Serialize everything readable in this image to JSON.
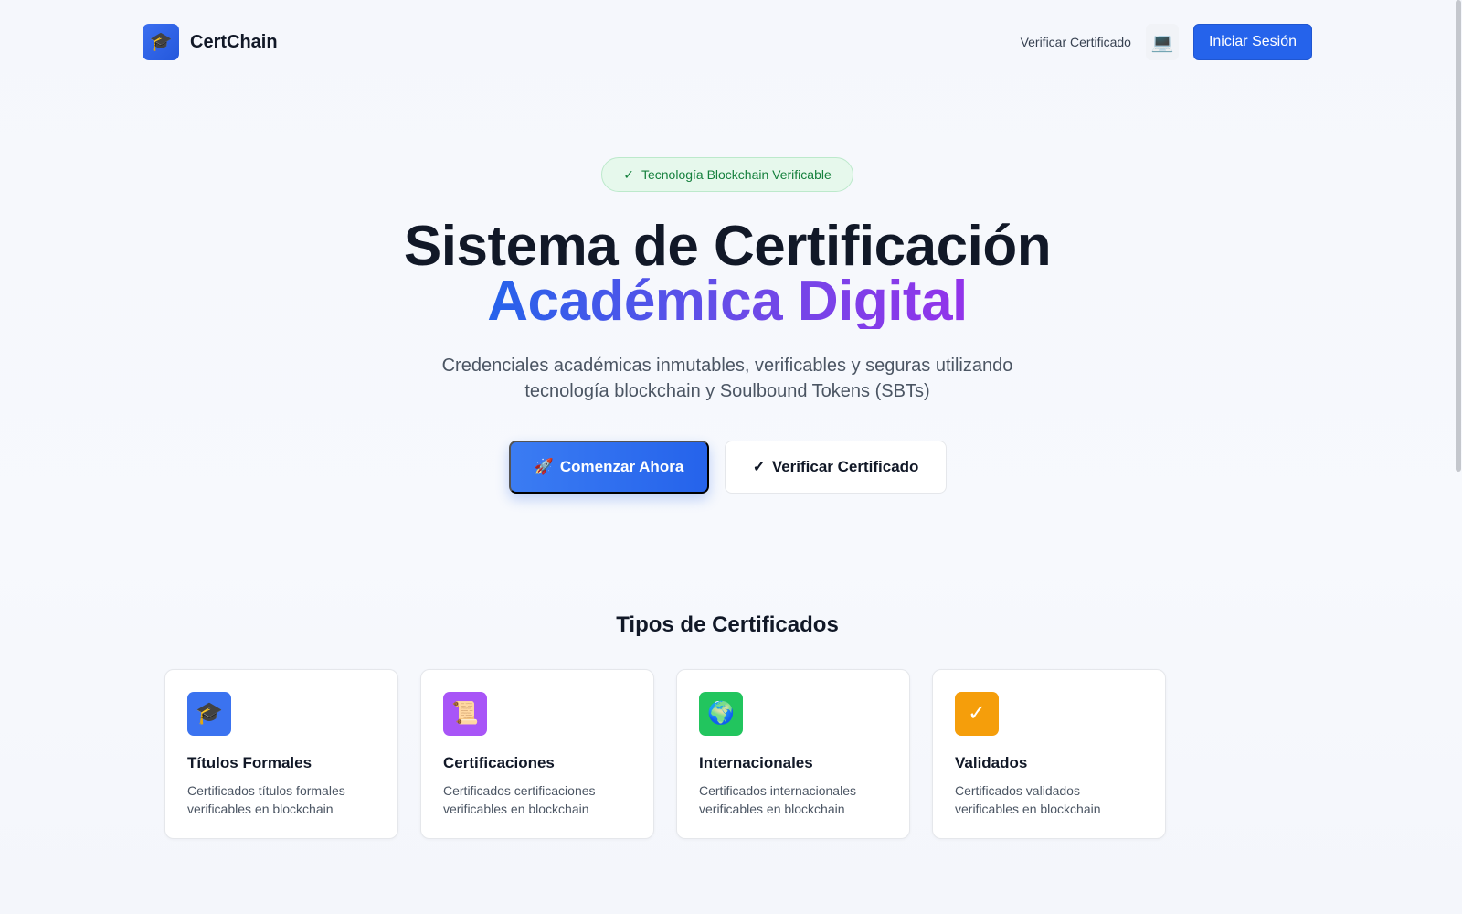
{
  "header": {
    "brand_icon": "🎓",
    "brand_name": "CertChain",
    "nav_link": "Verificar Certificado",
    "device_icon": "💻",
    "login_label": "Iniciar Sesión"
  },
  "hero": {
    "badge_check": "✓",
    "badge_text": "Tecnología Blockchain Verificable",
    "title_line1": "Sistema de Certificación",
    "title_line2": "Académica Digital",
    "subtitle": "Credenciales académicas inmutables, verificables y seguras utilizando tecnología blockchain y Soulbound Tokens (SBTs)",
    "cta_primary_icon": "🚀",
    "cta_primary_label": "Comenzar Ahora",
    "cta_secondary_icon": "✓",
    "cta_secondary_label": "Verificar Certificado"
  },
  "types": {
    "section_title": "Tipos de Certificados",
    "cards": [
      {
        "icon": "🎓",
        "icon_name": "graduation-cap-icon",
        "color": "#3b73f0",
        "title": "Títulos Formales",
        "description": "Certificados títulos formales verificables en blockchain"
      },
      {
        "icon": "📜",
        "icon_name": "scroll-icon",
        "color": "#a855f7",
        "title": "Certificaciones",
        "description": "Certificados certificaciones verificables en blockchain"
      },
      {
        "icon": "🌍",
        "icon_name": "globe-icon",
        "color": "#22c55e",
        "title": "Internacionales",
        "description": "Certificados internacionales verificables en blockchain"
      },
      {
        "icon": "✓",
        "icon_name": "check-icon",
        "color": "#f59e0b",
        "title": "Validados",
        "description": "Certificados validados verificables en blockchain"
      }
    ]
  },
  "colors": {
    "primary": "#2563eb",
    "accent_purple": "#9333ea",
    "badge_green": "#15803d"
  }
}
